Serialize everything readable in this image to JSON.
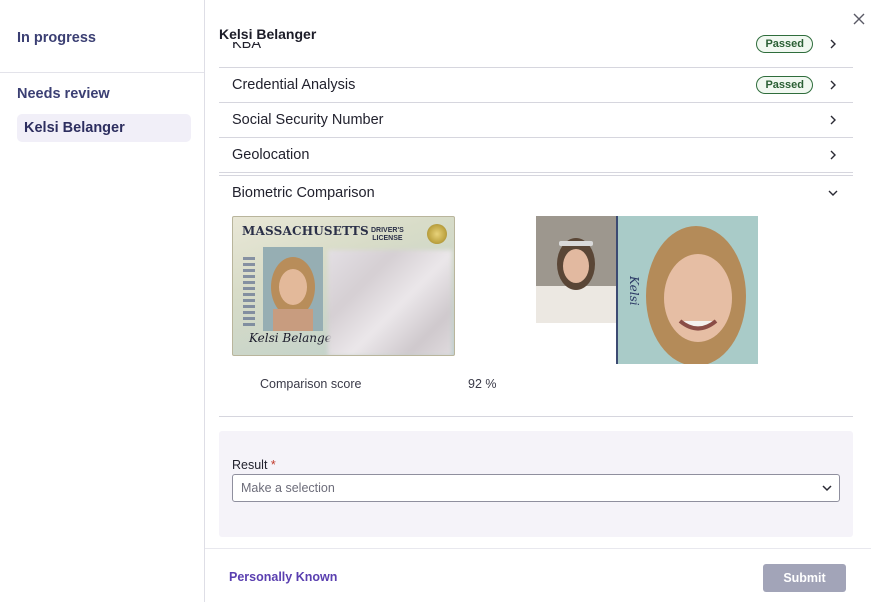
{
  "sidebar": {
    "in_progress_heading": "In progress",
    "needs_review_heading": "Needs review",
    "items": [
      {
        "label": "Kelsi Belanger",
        "selected": true
      }
    ]
  },
  "main": {
    "title": "Kelsi Belanger",
    "rows": [
      {
        "label": "KBA",
        "badge": "Passed",
        "icon": "chevron-right-icon"
      },
      {
        "label": "Credential Analysis",
        "badge": "Passed",
        "icon": "chevron-right-icon"
      },
      {
        "label": "Social Security Number",
        "icon": "chevron-right-icon"
      },
      {
        "label": "Geolocation",
        "icon": "chevron-right-icon"
      },
      {
        "label": "Biometric Comparison",
        "icon": "chevron-down-icon",
        "expanded": true
      }
    ],
    "biometric": {
      "id_card": {
        "state": "MASSACHUSETTS",
        "type_line1": "DRIVER'S",
        "type_line2": "LICENSE",
        "signature": "Kelsi Belanger"
      },
      "comparison_score_label": "Comparison score",
      "comparison_score_value": "92 %"
    },
    "result": {
      "label": "Result",
      "required_marker": "*",
      "placeholder": "Make a selection"
    }
  },
  "footer": {
    "personally_known_label": "Personally Known",
    "submit_label": "Submit"
  },
  "colors": {
    "accent": "#5a3fb0",
    "sidebar_heading": "#3b3f73",
    "passed_border": "#2f6d3c",
    "submit_disabled": "#a2a4b8"
  }
}
